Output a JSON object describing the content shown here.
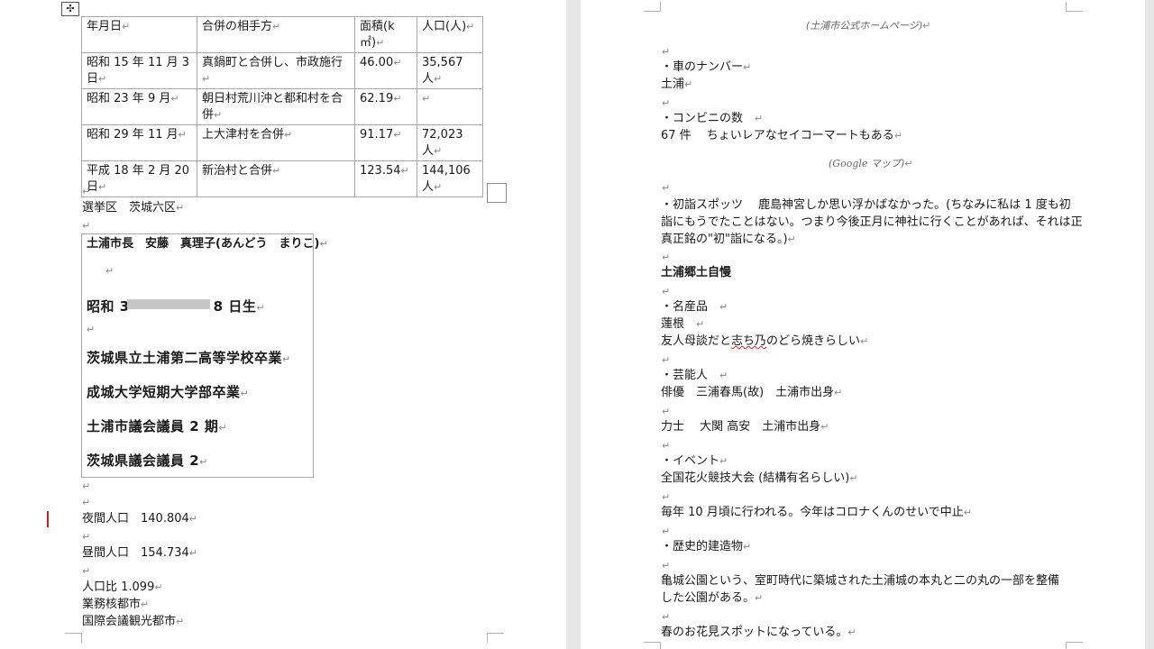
{
  "left_page": {
    "table": {
      "headers": [
        "年月日",
        "合併の相手方",
        "面積(k㎡)",
        "人口(人)"
      ],
      "rows": [
        [
          "昭和 15 年 11 月 3 日",
          "真鍋町と合併し、市政施行",
          "46.00",
          "35,567 人"
        ],
        [
          "昭和 23 年 9 月",
          "朝日村荒川沖と都和村を合併",
          "62.19",
          ""
        ],
        [
          "昭和 29 年 11 月",
          "上大津村を合併",
          "91.17",
          "72,023 人"
        ],
        [
          "平成 18 年 2 月 20 日",
          "新治村と合併",
          "123.54",
          "144,106 人"
        ]
      ]
    },
    "move_handle": "✣",
    "electoral_district": "選挙区　茨城六区",
    "profile": {
      "mayor": "土浦市長　安藤　真理子(あんどう　まりこ)",
      "birth": "昭和 3　　　　　　8 日生",
      "school": "茨城県立土浦第二高等学校卒業",
      "college": "成城大学短期大学部卒業",
      "city_council": "土浦市議会議員 2 期",
      "pref_council": "茨城県議会議員 2"
    },
    "night_pop": "夜間人口　140.804",
    "day_pop": "昼間人口　154.734",
    "pop_ratio": "人口比 1.099",
    "core_city": "業務核都市",
    "convention_city": "国際会議観光都市"
  },
  "right_page": {
    "source_caption": "(土浦市公式ホームページ)",
    "car_number_heading": "・車のナンバー",
    "car_number": "土浦",
    "convenience_heading": "・コンビニの数",
    "convenience_text": "67 件　 ちょいレアなセイコーマートもある",
    "google_caption": "(Google マップ)",
    "hatsumode_line1": "・初詣スポッツ　 鹿島神宮しか思い浮かばなかった。(ちなみに私は 1 度も初",
    "hatsumode_line2": "詣にもうでたことはない。つまり今後正月に神社に行くことがあれば、それは正",
    "hatsumode_line3": "真正銘の\"初\"詣になる。)",
    "pride_heading": "土浦郷土自慢",
    "products_heading": "・名産品",
    "product_1": "蓮根",
    "product_2_a": "友人母談だと",
    "product_2_b": "志ち乃",
    "product_2_c": "のどら焼きらしい",
    "celebrity_heading": "・芸能人",
    "actor": "俳優　三浦春馬(故)　土浦市出身",
    "rikishi": "力士　 大関 高安　土浦市出身",
    "event_heading": "・イベント",
    "event_name": "全国花火競技大会 (結構有名らしい)",
    "event_detail": "毎年 10 月頃に行われる。今年はコロナくんのせいで中止",
    "historic_heading": "・歴史的建造物",
    "historic_line1": "亀城公園という、室町時代に築城された土浦城の本丸と二の丸の一部を整備",
    "historic_line2": "した公園がある。",
    "hanami": "春のお花見スポットになっている。"
  },
  "marks": {
    "para": "↵"
  }
}
